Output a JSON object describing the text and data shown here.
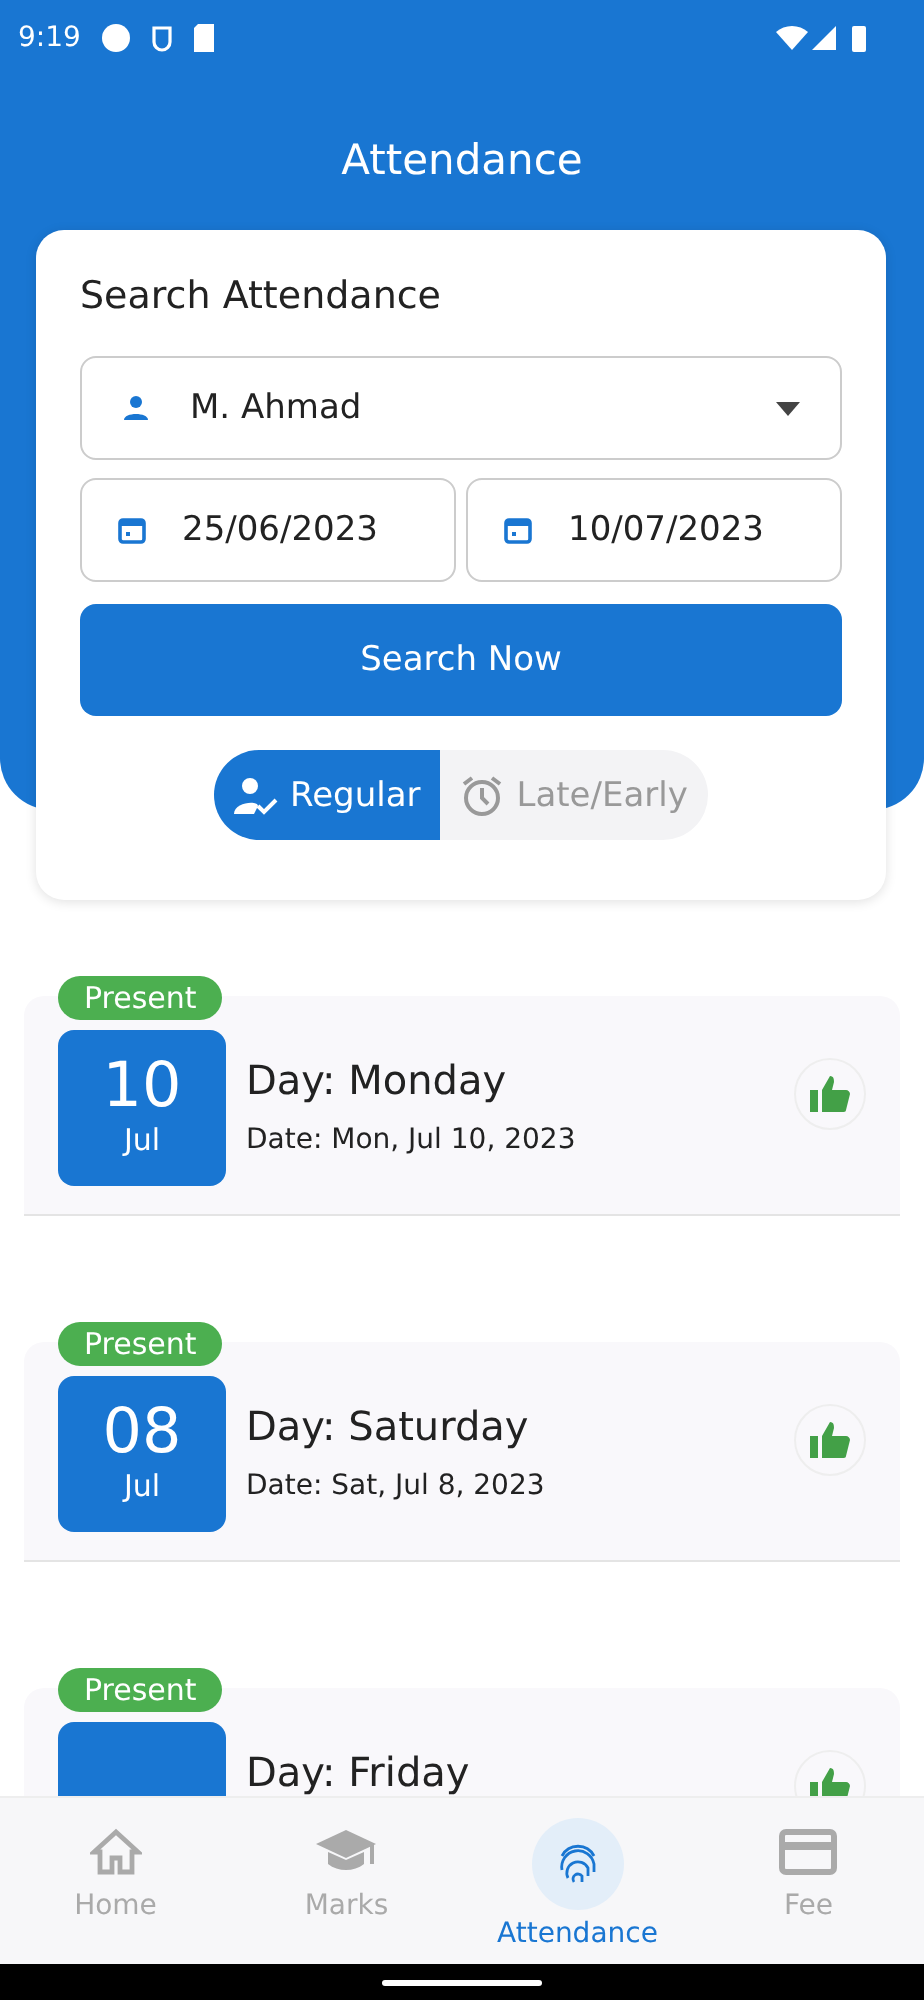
{
  "status_bar": {
    "time": "9:19"
  },
  "title": "Attendance",
  "search": {
    "heading": "Search Attendance",
    "student": "M. Ahmad",
    "from_date": "25/06/2023",
    "to_date": "10/07/2023",
    "button": "Search Now"
  },
  "modes": [
    {
      "label": "Regular",
      "selected": true
    },
    {
      "label": "Late/Early",
      "selected": false
    }
  ],
  "records": [
    {
      "status": "Present",
      "day_num": "10",
      "month": "Jul",
      "day": "Day:  Monday",
      "date": "Date: Mon, Jul 10, 2023",
      "liked": true
    },
    {
      "status": "Present",
      "day_num": "08",
      "month": "Jul",
      "day": "Day:  Saturday",
      "date": "Date: Sat, Jul 8, 2023",
      "liked": true
    },
    {
      "status": "Present",
      "day": "Day:  Friday",
      "liked": true
    }
  ],
  "nav": [
    {
      "label": "Home",
      "kind": "home",
      "selected": false
    },
    {
      "label": "Marks",
      "kind": "marks",
      "selected": false
    },
    {
      "label": "Attendance",
      "kind": "attendance",
      "selected": true
    },
    {
      "label": "Fee",
      "kind": "fee",
      "selected": false
    }
  ]
}
